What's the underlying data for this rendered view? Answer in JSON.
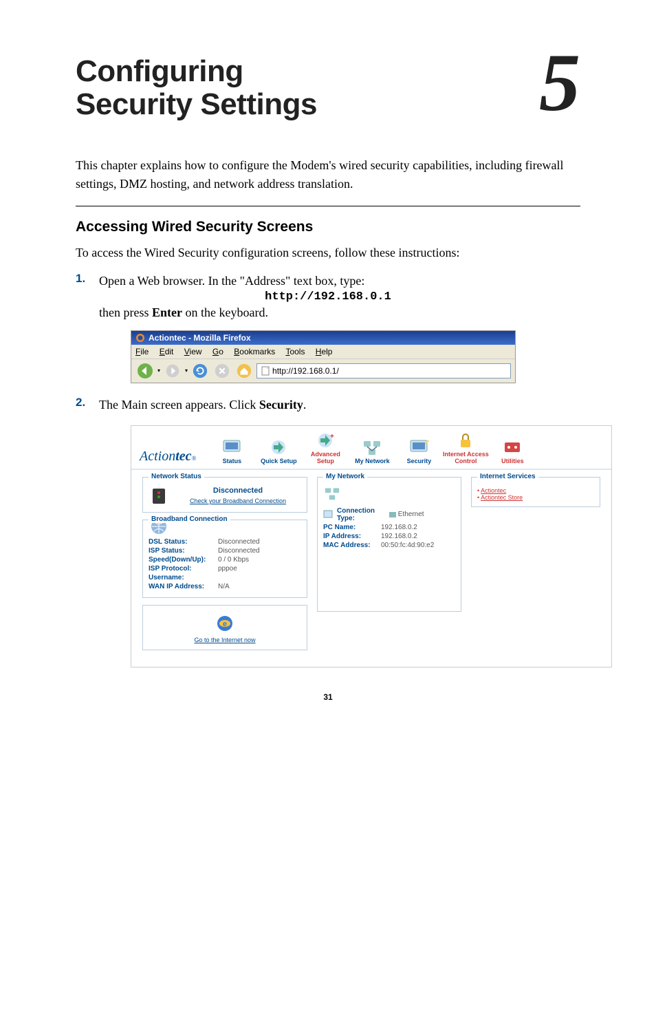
{
  "chapter": {
    "title_line1": "Configuring",
    "title_line2": "Security Settings",
    "number": "5"
  },
  "intro": "This chapter explains how to configure the Modem's wired security capabilities, including firewall settings, DMZ hosting, and network address translation.",
  "section_heading": "Accessing Wired Security Screens",
  "section_intro": "To access the Wired Security configuration screens, follow these instructions:",
  "steps": {
    "s1_num": "1.",
    "s1_text": "Open a Web browser. In the \"Address\" text box, type:",
    "s1_url": "http://192.168.0.1",
    "s1_cont_a": "then press ",
    "s1_cont_b": "Enter",
    "s1_cont_c": " on the keyboard.",
    "s2_num": "2.",
    "s2_text_a": "The Main screen appears. Click ",
    "s2_text_b": "Security",
    "s2_text_c": "."
  },
  "browser": {
    "title": "Actiontec - Mozilla Firefox",
    "menu_file": "File",
    "menu_edit": "Edit",
    "menu_view": "View",
    "menu_go": "Go",
    "menu_bookmarks": "Bookmarks",
    "menu_tools": "Tools",
    "menu_help": "Help",
    "address": "http://192.168.0.1/"
  },
  "router": {
    "logo": "Action",
    "logo2": "tec",
    "nav": {
      "status": "Status",
      "quick": "Quick Setup",
      "advanced": "Advanced Setup",
      "mynet": "My Network",
      "security": "Security",
      "iac": "Internet Access Control",
      "util": "Utilities"
    },
    "panel_netstatus_title": "Network Status",
    "disconnected": "Disconnected",
    "check_broadband": "Check your Broadband Connection",
    "panel_bbc_title": "Broadband Connection",
    "dsl_lbl": "DSL Status:",
    "dsl_val": "Disconnected",
    "isp_lbl": "ISP Status:",
    "isp_val": "Disconnected",
    "speed_lbl": "Speed(Down/Up):",
    "speed_val": "0 / 0 Kbps",
    "proto_lbl": "ISP Protocol:",
    "proto_val": "pppoe",
    "user_lbl": "Username:",
    "user_val": "",
    "wan_lbl": "WAN IP Address:",
    "wan_val": "N/A",
    "go_internet": "Go to the Internet now",
    "panel_mynet_title": "My Network",
    "conn_type_lbl": "Connection Type:",
    "conn_type_val": "Ethernet",
    "pcname_lbl": "PC Name:",
    "pcname_val": "192.168.0.2",
    "ip_lbl": "IP Address:",
    "ip_val": "192.168.0.2",
    "mac_lbl": "MAC Address:",
    "mac_val": "00:50:fc:4d:90:e2",
    "panel_svc_title": "Internet Services",
    "svc1": "Actiontec",
    "svc2": "Actiontec Store"
  },
  "page_number": "31"
}
